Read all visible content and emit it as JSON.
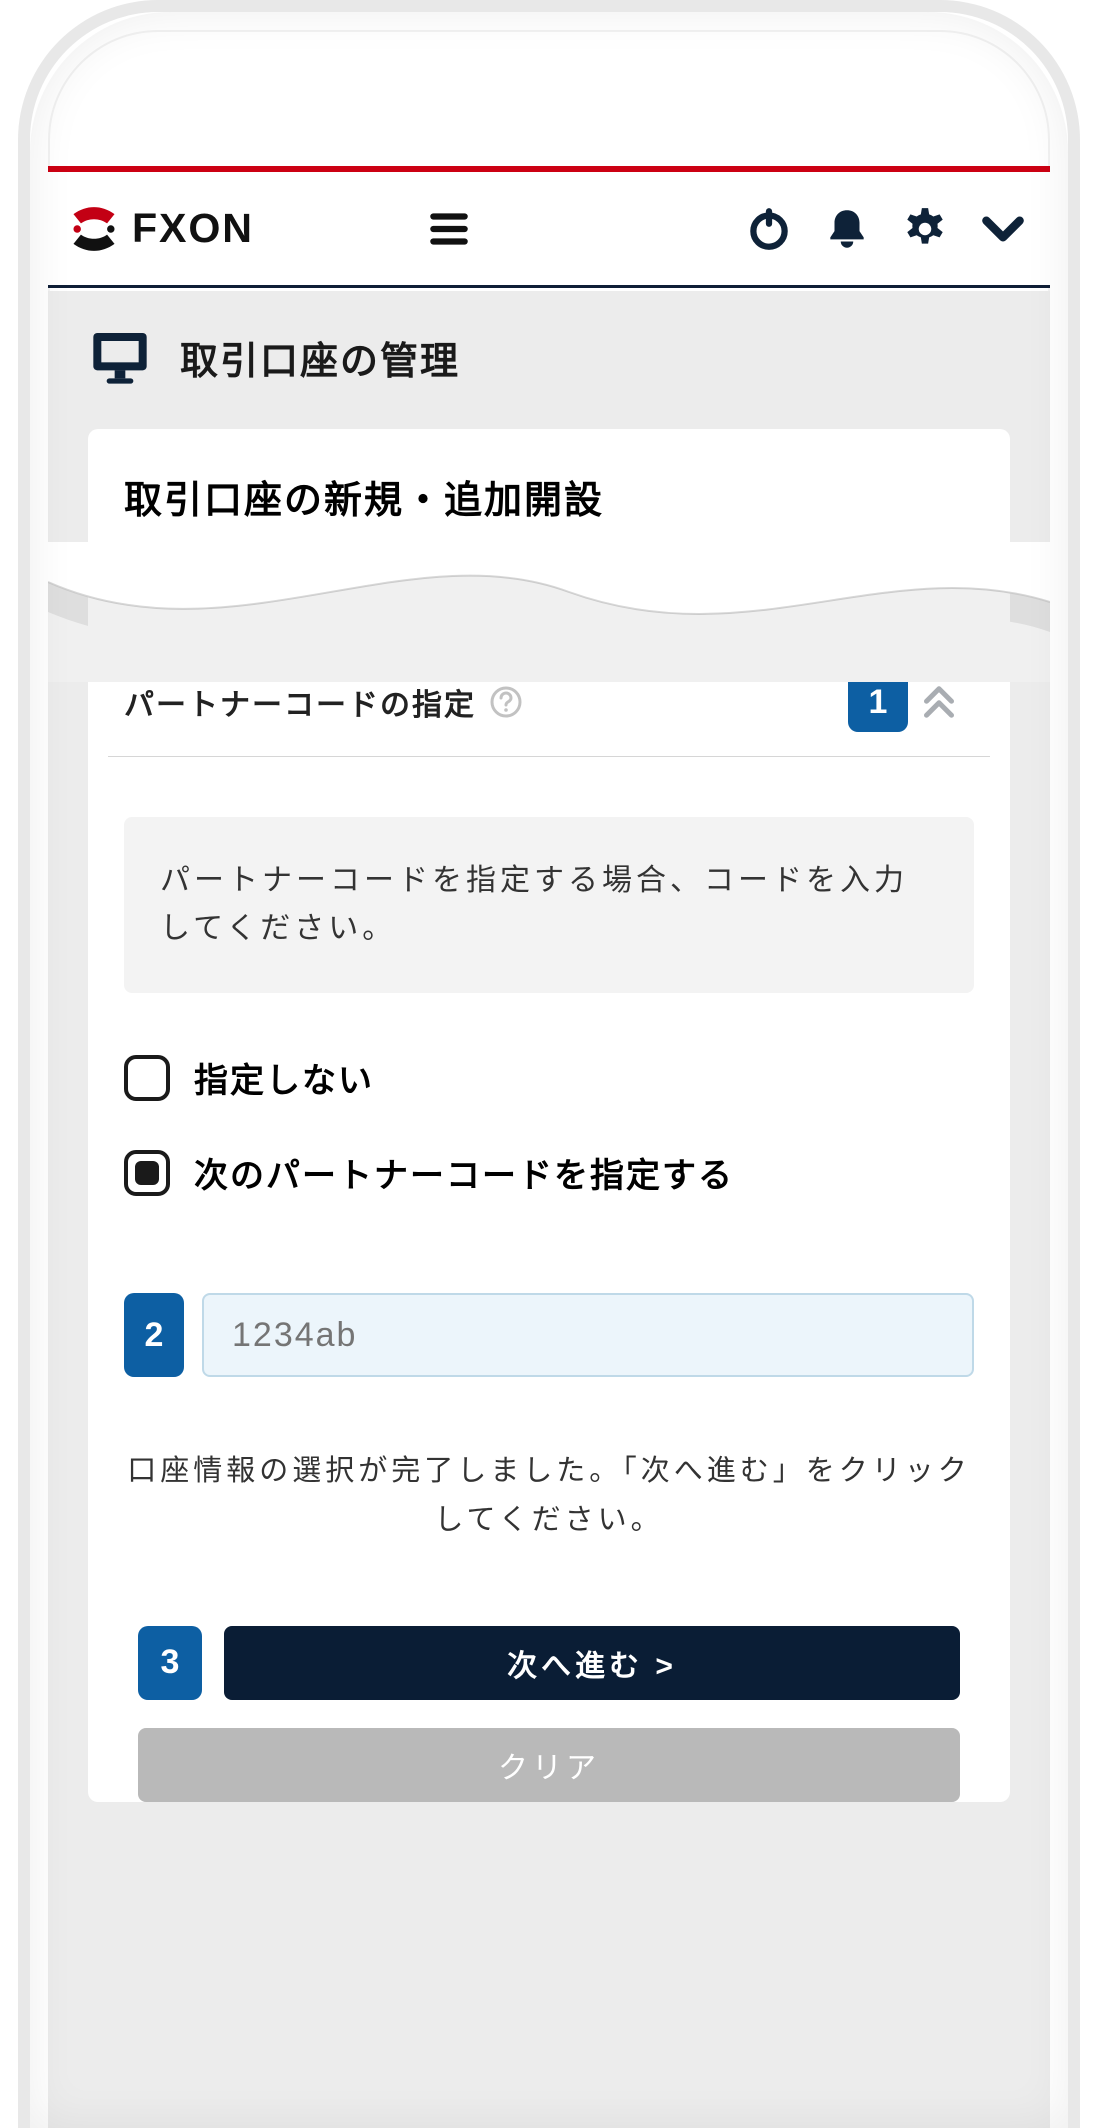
{
  "header": {
    "brand_word": "FXON",
    "icons": {
      "menu": "menu-icon",
      "power": "power-icon",
      "bell": "bell-icon",
      "gear": "gear-icon",
      "chevron_down": "chevron-down-icon"
    }
  },
  "page": {
    "title_icon": "monitor-icon",
    "title": "取引口座の管理"
  },
  "card": {
    "title": "取引口座の新規・追加開設",
    "section_label": "パートナーコードの指定",
    "help_icon": "question-circle-icon",
    "step1": "1",
    "collapse_icon": "chevron-double-up-icon",
    "info": "パートナーコードを指定する場合、コードを入力してください。",
    "radio_none": "指定しない",
    "radio_specify": "次のパートナーコードを指定する",
    "step2": "2",
    "code_value": "",
    "code_placeholder": "1234ab",
    "notice": "口座情報の選択が完了しました。「次へ進む」をクリックしてください。",
    "step3": "3",
    "btn_next": "次へ進む >",
    "btn_clear": "クリア"
  },
  "state": {
    "selected_radio": "specify"
  }
}
